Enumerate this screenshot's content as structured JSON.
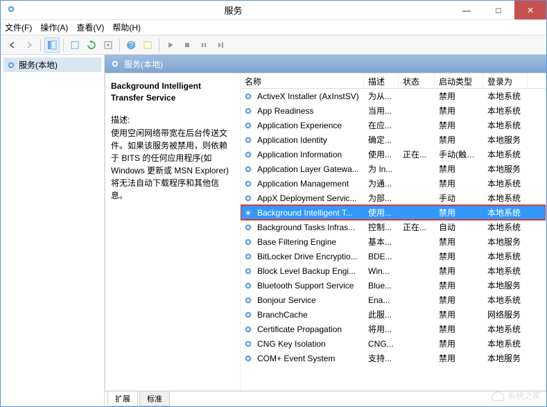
{
  "window": {
    "title": "服务",
    "min": "—",
    "max": "□",
    "close": "✕"
  },
  "menu": {
    "file": "文件(F)",
    "action": "操作(A)",
    "view": "查看(V)",
    "help": "帮助(H)"
  },
  "tree": {
    "root": "服务(本地)"
  },
  "panel": {
    "title": "服务(本地)"
  },
  "detail": {
    "name": "Background Intelligent Transfer Service",
    "desc_label": "描述:",
    "desc": "使用空闲网络带宽在后台传送文件。如果该服务被禁用，则依赖于 BITS 的任何应用程序(如 Windows 更新或 MSN Explorer)将无法自动下载程序和其他信息。"
  },
  "columns": {
    "name": "名称",
    "desc": "描述",
    "status": "状态",
    "start": "启动类型",
    "logon": "登录为"
  },
  "services": [
    {
      "name": "ActiveX Installer (AxInstSV)",
      "desc": "为从...",
      "status": "",
      "start": "禁用",
      "logon": "本地系统",
      "selected": false
    },
    {
      "name": "App Readiness",
      "desc": "当用...",
      "status": "",
      "start": "禁用",
      "logon": "本地系统",
      "selected": false
    },
    {
      "name": "Application Experience",
      "desc": "在应...",
      "status": "",
      "start": "禁用",
      "logon": "本地系统",
      "selected": false
    },
    {
      "name": "Application Identity",
      "desc": "确定...",
      "status": "",
      "start": "禁用",
      "logon": "本地服务",
      "selected": false
    },
    {
      "name": "Application Information",
      "desc": "使用...",
      "status": "正在...",
      "start": "手动(触发...",
      "logon": "本地系统",
      "selected": false
    },
    {
      "name": "Application Layer Gatewa...",
      "desc": "为 In...",
      "status": "",
      "start": "禁用",
      "logon": "本地服务",
      "selected": false
    },
    {
      "name": "Application Management",
      "desc": "为通...",
      "status": "",
      "start": "禁用",
      "logon": "本地系统",
      "selected": false
    },
    {
      "name": "AppX Deployment Servic...",
      "desc": "为部...",
      "status": "",
      "start": "手动",
      "logon": "本地系统",
      "selected": false
    },
    {
      "name": "Background Intelligent T...",
      "desc": "使用...",
      "status": "",
      "start": "禁用",
      "logon": "本地系统",
      "selected": true
    },
    {
      "name": "Background Tasks Infras...",
      "desc": "控制...",
      "status": "正在...",
      "start": "自动",
      "logon": "本地系统",
      "selected": false
    },
    {
      "name": "Base Filtering Engine",
      "desc": "基本...",
      "status": "",
      "start": "禁用",
      "logon": "本地服务",
      "selected": false
    },
    {
      "name": "BitLocker Drive Encryptio...",
      "desc": "BDE...",
      "status": "",
      "start": "禁用",
      "logon": "本地系统",
      "selected": false
    },
    {
      "name": "Block Level Backup Engi...",
      "desc": "Win...",
      "status": "",
      "start": "禁用",
      "logon": "本地系统",
      "selected": false
    },
    {
      "name": "Bluetooth Support Service",
      "desc": "Blue...",
      "status": "",
      "start": "禁用",
      "logon": "本地服务",
      "selected": false
    },
    {
      "name": "Bonjour Service",
      "desc": "Ena...",
      "status": "",
      "start": "禁用",
      "logon": "本地系统",
      "selected": false
    },
    {
      "name": "BranchCache",
      "desc": "此服...",
      "status": "",
      "start": "禁用",
      "logon": "网络服务",
      "selected": false
    },
    {
      "name": "Certificate Propagation",
      "desc": "将用...",
      "status": "",
      "start": "禁用",
      "logon": "本地系统",
      "selected": false
    },
    {
      "name": "CNG Key Isolation",
      "desc": "CNG...",
      "status": "",
      "start": "禁用",
      "logon": "本地系统",
      "selected": false
    },
    {
      "name": "COM+ Event System",
      "desc": "支持...",
      "status": "",
      "start": "禁用",
      "logon": "本地服务",
      "selected": false
    }
  ],
  "tabs": {
    "extended": "扩展",
    "standard": "标准"
  },
  "watermark": "系统之家"
}
